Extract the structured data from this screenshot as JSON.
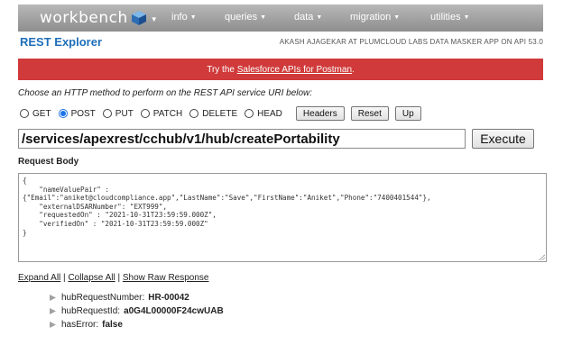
{
  "nav": {
    "logo_text": "workbench",
    "menus": [
      "info",
      "queries",
      "data",
      "migration",
      "utilities"
    ]
  },
  "header": {
    "title": "REST Explorer",
    "user_info": "AKASH AJAGEKAR AT PLUMCLOUD LABS DATA MASKER APP ON API 53.0"
  },
  "banner": {
    "prefix": "Try the ",
    "link": "Salesforce APIs for Postman",
    "suffix": "."
  },
  "instruction": "Choose an HTTP method to perform on the REST API service URI below:",
  "methods": {
    "options": [
      "GET",
      "POST",
      "PUT",
      "PATCH",
      "DELETE",
      "HEAD"
    ],
    "selected": "POST"
  },
  "buttons": {
    "headers": "Headers",
    "reset": "Reset",
    "up": "Up",
    "execute": "Execute"
  },
  "uri": "/services/apexrest/cchub/v1/hub/createPortability",
  "request_body": {
    "label": "Request Body",
    "value": "{\n    \"nameValuePair\" :\n{\"Email\":\"aniket@cloudcompliance.app\",\"LastName\":\"Save\",\"FirstName\":\"Aniket\",\"Phone\":\"7400401544\"},\n    \"externalDSARNumber\": \"EXT999\",\n    \"requestedOn\" : \"2021-10-31T23:59:59.000Z\",\n    \"verifiedOn\" : \"2021-10-31T23:59:59.000Z\"\n}"
  },
  "links": {
    "expand": "Expand All",
    "collapse": "Collapse All",
    "raw": "Show Raw Response",
    "sep": "|"
  },
  "results": [
    {
      "key": "hubRequestNumber:",
      "value": "HR-00042"
    },
    {
      "key": "hubRequestId:",
      "value": "a0G4L00000F24cwUAB"
    },
    {
      "key": "hasError:",
      "value": "false"
    }
  ],
  "colors": {
    "brand_blue": "#1e6fb8",
    "banner_red": "#d03a3a",
    "nav_gray": "#9e9e9e"
  }
}
